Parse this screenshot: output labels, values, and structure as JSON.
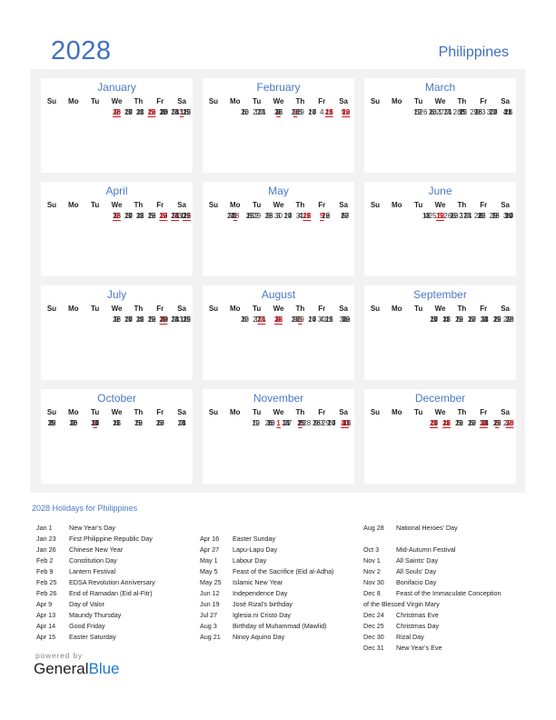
{
  "header": {
    "year": "2028",
    "country": "Philippines"
  },
  "weekday_labels": [
    "Su",
    "Mo",
    "Tu",
    "We",
    "Th",
    "Fr",
    "Sa"
  ],
  "months": [
    {
      "name": "January",
      "start": 6,
      "days": 31,
      "holidays": [
        1,
        23,
        26
      ]
    },
    {
      "name": "February",
      "start": 2,
      "days": 29,
      "holidays": [
        2,
        9,
        25,
        26
      ]
    },
    {
      "name": "March",
      "start": 3,
      "days": 31,
      "holidays": []
    },
    {
      "name": "April",
      "start": 6,
      "days": 30,
      "holidays": [
        9,
        13,
        14,
        15,
        16,
        27
      ]
    },
    {
      "name": "May",
      "start": 1,
      "days": 31,
      "holidays": [
        1,
        5,
        25
      ]
    },
    {
      "name": "June",
      "start": 4,
      "days": 30,
      "holidays": [
        12,
        19
      ]
    },
    {
      "name": "July",
      "start": 6,
      "days": 31,
      "holidays": [
        27
      ]
    },
    {
      "name": "August",
      "start": 2,
      "days": 31,
      "holidays": [
        3,
        21,
        28
      ]
    },
    {
      "name": "September",
      "start": 5,
      "days": 30,
      "holidays": []
    },
    {
      "name": "October",
      "start": 0,
      "days": 31,
      "holidays": [
        3
      ]
    },
    {
      "name": "November",
      "start": 3,
      "days": 30,
      "holidays": [
        1,
        2,
        30
      ]
    },
    {
      "name": "December",
      "start": 5,
      "days": 31,
      "holidays": [
        8,
        24,
        25,
        30,
        31
      ]
    }
  ],
  "holidays_title": "2028 Holidays for Philippines",
  "holiday_columns": [
    [
      {
        "date": "Jan 1",
        "name": "New Year’s Day"
      },
      {
        "date": "Jan 23",
        "name": "First Philippine Republic Day"
      },
      {
        "date": "Jan 26",
        "name": "Chinese New Year"
      },
      {
        "date": "Feb 2",
        "name": "Constitution Day"
      },
      {
        "date": "Feb 9",
        "name": "Lantern Festival"
      },
      {
        "date": "Feb 25",
        "name": "EDSA Revolution Anniversary"
      },
      {
        "date": "Feb 26",
        "name": "End of Ramadan (Eid al-Fitr)"
      },
      {
        "date": "Apr 9",
        "name": "Day of Valor"
      },
      {
        "date": "Apr 13",
        "name": "Maundy Thursday"
      },
      {
        "date": "Apr 14",
        "name": "Good Friday"
      },
      {
        "date": "Apr 15",
        "name": "Easter Saturday"
      }
    ],
    [
      {
        "date": "",
        "name": ""
      },
      {
        "date": "Apr 16",
        "name": "Easter Sunday"
      },
      {
        "date": "Apr 27",
        "name": "Lapu-Lapu Day"
      },
      {
        "date": "May 1",
        "name": "Labour Day"
      },
      {
        "date": "May 5",
        "name": "Feast of the Sacrifice (Eid al-Adha)"
      },
      {
        "date": "May 25",
        "name": "Islamic New Year"
      },
      {
        "date": "Jun 12",
        "name": "Independence Day"
      },
      {
        "date": "Jun 19",
        "name": "José Rizal’s birthday"
      },
      {
        "date": "Jul 27",
        "name": "Iglesia ni Cristo Day"
      },
      {
        "date": "Aug 3",
        "name": "Birthday of Muhammad (Mawlid)"
      },
      {
        "date": "Aug 21",
        "name": "Ninoy Aquino Day"
      }
    ],
    [
      {
        "date": "Aug 28",
        "name": "National Heroes’ Day"
      },
      {
        "date": "",
        "name": ""
      },
      {
        "date": "Oct 3",
        "name": "Mid-Autumn Festival"
      },
      {
        "date": "Nov 1",
        "name": "All Saints’ Day"
      },
      {
        "date": "Nov 2",
        "name": "All Souls’ Day"
      },
      {
        "date": "Nov 30",
        "name": "Bonifacio Day"
      },
      {
        "date": "Dec 8",
        "name": "Feast of the Immaculate Conception"
      },
      {
        "date": "",
        "name": "of the Blessed Virgin Mary",
        "wrap": true
      },
      {
        "date": "Dec 24",
        "name": "Christmas Eve"
      },
      {
        "date": "Dec 25",
        "name": "Christmas Day"
      },
      {
        "date": "Dec 30",
        "name": "Rizal Day"
      },
      {
        "date": "Dec 31",
        "name": "New Year’s Eve"
      }
    ]
  ],
  "footer": {
    "powered_by": "powered by",
    "brand_general": "General",
    "brand_blue": "Blue"
  }
}
